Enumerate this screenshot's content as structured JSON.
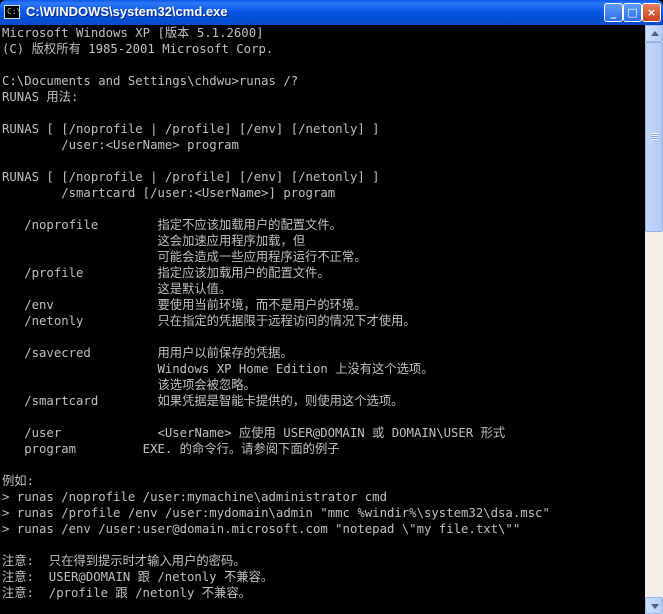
{
  "window": {
    "title": "C:\\WINDOWS\\system32\\cmd.exe",
    "icon": "cmd-icon",
    "controls": {
      "minimize": "_",
      "maximize": "□",
      "close": "×"
    }
  },
  "console": {
    "lines": [
      "Microsoft Windows XP [版本 5.1.2600]",
      "(C) 版权所有 1985-2001 Microsoft Corp.",
      "",
      "C:\\Documents and Settings\\chdwu>runas /?",
      "RUNAS 用法:",
      "",
      "RUNAS [ [/noprofile | /profile] [/env] [/netonly] ]",
      "        /user:<UserName> program",
      "",
      "RUNAS [ [/noprofile | /profile] [/env] [/netonly] ]",
      "        /smartcard [/user:<UserName>] program",
      "",
      "   /noprofile        指定不应该加载用户的配置文件。",
      "                     这会加速应用程序加载，但",
      "                     可能会造成一些应用程序运行不正常。",
      "   /profile          指定应该加载用户的配置文件。",
      "                     这是默认值。",
      "   /env              要使用当前环境，而不是用户的环境。",
      "   /netonly          只在指定的凭据限于远程访问的情况下才使用。",
      "",
      "   /savecred         用用户以前保存的凭据。",
      "                     Windows XP Home Edition 上没有这个选项。",
      "                     该选项会被忽略。",
      "   /smartcard        如果凭据是智能卡提供的，则使用这个选项。",
      "",
      "   /user             <UserName> 应使用 USER@DOMAIN 或 DOMAIN\\USER 形式",
      "   program         EXE. 的命令行。请参阅下面的例子",
      "",
      "例如:",
      "> runas /noprofile /user:mymachine\\administrator cmd",
      "> runas /profile /env /user:mydomain\\admin \"mmc %windir%\\system32\\dsa.msc\"",
      "> runas /env /user:user@domain.microsoft.com \"notepad \\\"my file.txt\\\"\"",
      "",
      "注意:  只在得到提示时才输入用户的密码。",
      "注意:  USER@DOMAIN 跟 /netonly 不兼容。",
      "注意:  /profile 跟 /netonly 不兼容。"
    ]
  },
  "colors": {
    "console_bg": "#000000",
    "console_text": "#c0c0c0",
    "titlebar": "#0450d8"
  }
}
